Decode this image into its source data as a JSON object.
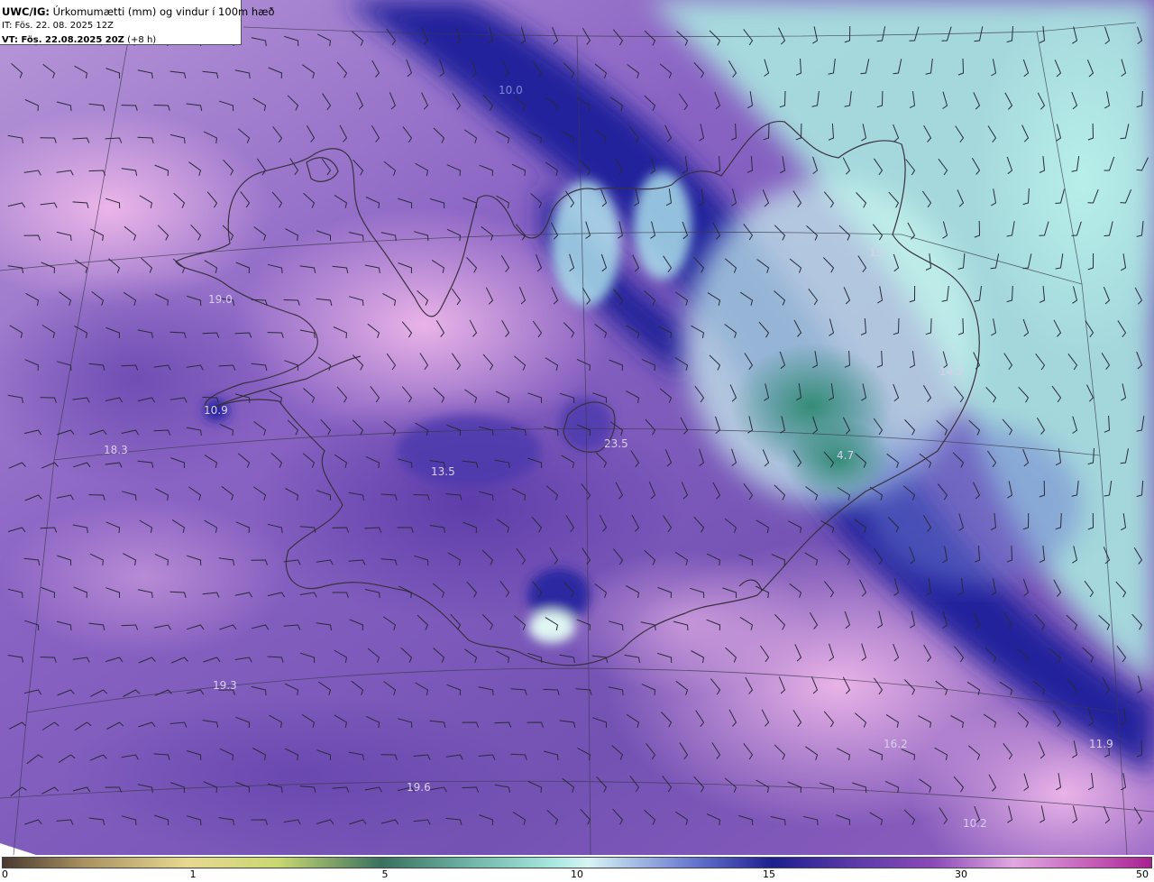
{
  "header": {
    "product": "UWC/IG:",
    "description": " Úrkomumætti (mm) og vindur í 100m hæð",
    "init_time": "IT: Fös. 22. 08. 2025 12Z",
    "valid_label": "VT:",
    "valid_time": " Fös. 22.08.2025 20Z",
    "lead": " (+8 h)"
  },
  "map_values": [
    {
      "id": "v1",
      "text": "10.0"
    },
    {
      "id": "v2",
      "text": "19.0"
    },
    {
      "id": "v3",
      "text": "10.9"
    },
    {
      "id": "v4",
      "text": "18.3"
    },
    {
      "id": "v5",
      "text": "13.5"
    },
    {
      "id": "v6",
      "text": "23.5"
    },
    {
      "id": "v7",
      "text": "15."
    },
    {
      "id": "v8",
      "text": "4.7"
    },
    {
      "id": "v9",
      "text": "19.3"
    },
    {
      "id": "v10",
      "text": "19.6"
    },
    {
      "id": "v11",
      "text": "11.9"
    },
    {
      "id": "v12",
      "text": "16.2"
    },
    {
      "id": "v13",
      "text": "14.2"
    },
    {
      "id": "v14",
      "text": "10.2"
    }
  ],
  "colorbar": {
    "ticks": [
      {
        "label": "0",
        "value": 0
      },
      {
        "label": "1",
        "value": 1
      },
      {
        "label": "5",
        "value": 5
      },
      {
        "label": "10",
        "value": 10
      },
      {
        "label": "15",
        "value": 15
      },
      {
        "label": "30",
        "value": 30
      },
      {
        "label": "50",
        "value": 50
      }
    ]
  },
  "colors": {
    "land_outline": "#3a3040",
    "wind_barb": "#2a2a3a",
    "purple_field": "#7a5ab8",
    "pink_field": "#e0a8e0",
    "deep_blue": "#2a2aa0",
    "cyan_field": "#a8e8e0",
    "teal_field": "#3a9a80"
  }
}
